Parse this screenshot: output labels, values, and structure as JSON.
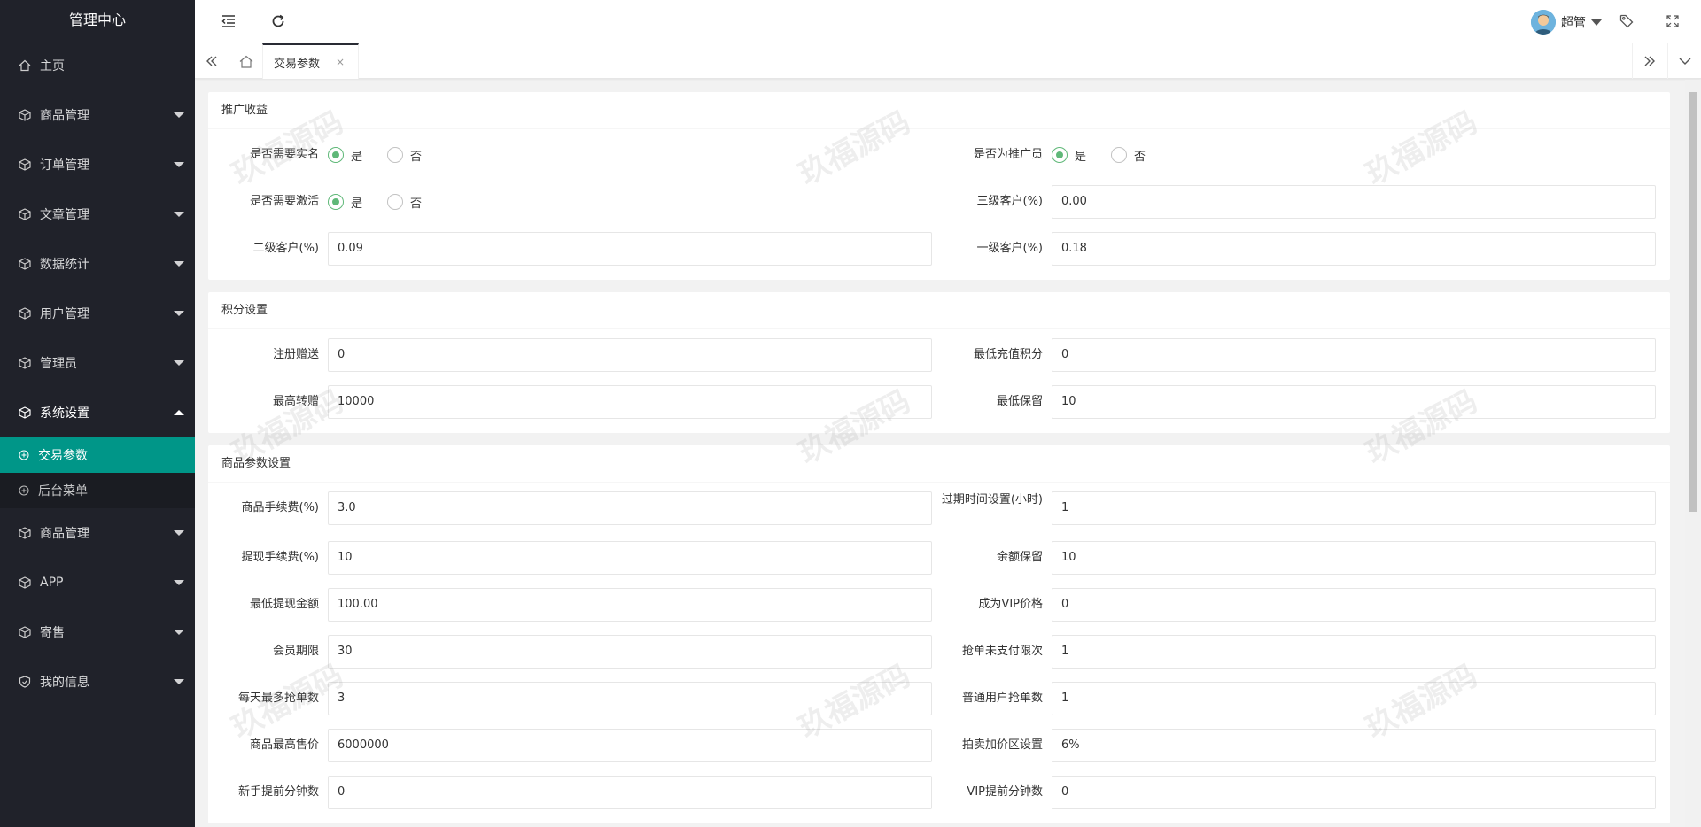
{
  "sidebar": {
    "title": "管理中心",
    "items": [
      {
        "label": "主页"
      },
      {
        "label": "商品管理"
      },
      {
        "label": "订单管理"
      },
      {
        "label": "文章管理"
      },
      {
        "label": "数据统计"
      },
      {
        "label": "用户管理"
      },
      {
        "label": "管理员"
      },
      {
        "label": "系统设置"
      },
      {
        "label": "商品管理"
      },
      {
        "label": "APP"
      },
      {
        "label": "寄售"
      },
      {
        "label": "我的信息"
      }
    ],
    "sub_items": [
      {
        "label": "交易参数"
      },
      {
        "label": "后台菜单"
      }
    ]
  },
  "header": {
    "user_name": "超管"
  },
  "tabs": {
    "active": "交易参数",
    "close": "×"
  },
  "watermark": "玖福源码",
  "sections": {
    "promo": {
      "title": "推广收益",
      "need_realname_label": "是否需要实名",
      "is_promoter_label": "是否为推广员",
      "need_activate_label": "是否需要激活",
      "yes": "是",
      "no": "否",
      "level3_label": "三级客户(%)",
      "level3_value": "0.00",
      "level2_label": "二级客户(%)",
      "level2_value": "0.09",
      "level1_label": "一级客户(%)",
      "level1_value": "0.18"
    },
    "points": {
      "title": "积分设置",
      "reg_gift_label": "注册赠送",
      "reg_gift_value": "0",
      "min_recharge_label": "最低充值积分",
      "min_recharge_value": "0",
      "max_transfer_label": "最高转赠",
      "max_transfer_value": "10000",
      "min_keep_label": "最低保留",
      "min_keep_value": "10"
    },
    "goods": {
      "title": "商品参数设置",
      "fee_label": "商品手续费(%)",
      "fee_value": "3.0",
      "expire_label": "过期时间设置(小时)",
      "expire_value": "1",
      "withdraw_fee_label": "提现手续费(%)",
      "withdraw_fee_value": "10",
      "balance_keep_label": "余额保留",
      "balance_keep_value": "10",
      "min_withdraw_label": "最低提现金额",
      "min_withdraw_value": "100.00",
      "vip_price_label": "成为VIP价格",
      "vip_price_value": "0",
      "member_term_label": "会员期限",
      "member_term_value": "30",
      "unpaid_limit_label": "抢单未支付限次",
      "unpaid_limit_value": "1",
      "daily_max_label": "每天最多抢单数",
      "daily_max_value": "3",
      "normal_user_label": "普通用户抢单数",
      "normal_user_value": "1",
      "max_price_label": "商品最高售价",
      "max_price_value": "6000000",
      "markup_label": "拍卖加价区设置",
      "markup_value": "6%",
      "newbie_advance_label": "新手提前分钟数",
      "newbie_advance_value": "0",
      "vip_advance_label": "VIP提前分钟数",
      "vip_advance_value": "0"
    }
  }
}
